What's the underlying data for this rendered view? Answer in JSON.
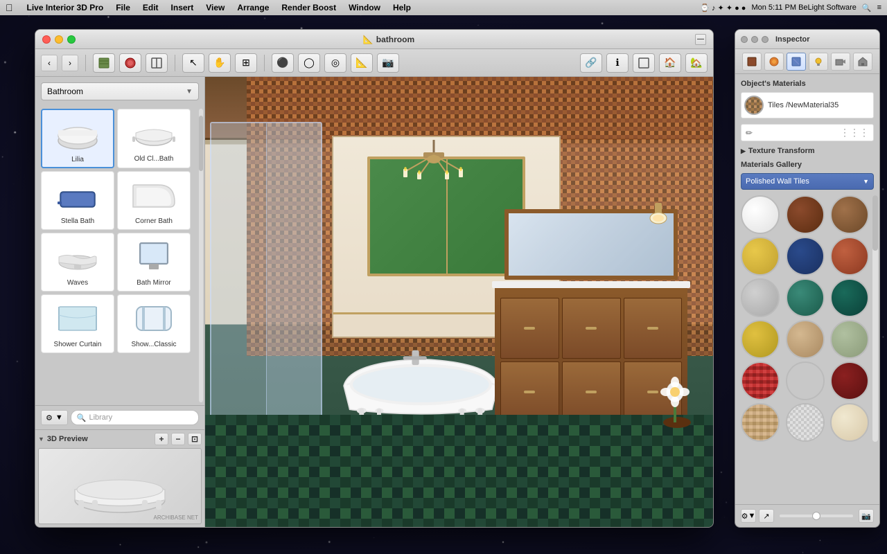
{
  "app": {
    "title": "Live Interior 3D Pro",
    "menu_items": [
      "File",
      "Edit",
      "Insert",
      "View",
      "Arrange",
      "Render Boost",
      "Window",
      "Help"
    ],
    "right_info": "Mon 5:11 PM",
    "company": "BeLight Software",
    "time_display": "Mon 5:11 PM   BeLight Software"
  },
  "main_window": {
    "title": "bathroom",
    "title_icon": "🏠"
  },
  "left_sidebar": {
    "category": "Bathroom",
    "items": [
      {
        "id": "lilia",
        "label": "Lilia",
        "selected": true
      },
      {
        "id": "old-bath",
        "label": "Old Cl...Bath"
      },
      {
        "id": "stella-bath",
        "label": "Stella Bath"
      },
      {
        "id": "corner-bath",
        "label": "Corner Bath"
      },
      {
        "id": "waves",
        "label": "Waves"
      },
      {
        "id": "bath-mirror",
        "label": "Bath Mirror"
      },
      {
        "id": "shower-curtain",
        "label": "Shower Curtain"
      },
      {
        "id": "show-classic",
        "label": "Show...Classic"
      }
    ],
    "search_placeholder": "Library",
    "preview_label": "3D Preview"
  },
  "inspector": {
    "title": "Inspector",
    "tabs": [
      "objects",
      "materials",
      "paint",
      "lights",
      "camera",
      "home"
    ],
    "objects_materials_label": "Object's Materials",
    "material_name": "Tiles /NewMaterial35",
    "texture_transform_label": "Texture Transform",
    "materials_gallery_label": "Materials Gallery",
    "gallery_selected": "Polished Wall Tiles",
    "materials": [
      {
        "id": "white",
        "class": "mat-white"
      },
      {
        "id": "dark-brown",
        "class": "mat-dark-brown"
      },
      {
        "id": "medium-brown",
        "class": "mat-medium-brown"
      },
      {
        "id": "yellow",
        "class": "mat-yellow"
      },
      {
        "id": "dark-blue",
        "class": "mat-dark-blue"
      },
      {
        "id": "terracotta",
        "class": "mat-terracotta"
      },
      {
        "id": "light-gray",
        "class": "mat-light-gray"
      },
      {
        "id": "teal",
        "class": "mat-teal"
      },
      {
        "id": "dark-teal",
        "class": "mat-dark-teal"
      },
      {
        "id": "gold-yellow",
        "class": "mat-gold-yellow"
      },
      {
        "id": "tan",
        "class": "mat-tan"
      },
      {
        "id": "sage",
        "class": "mat-sage"
      },
      {
        "id": "red-tile",
        "class": "mat-red-tile"
      },
      {
        "id": "blue-tile",
        "class": "mat-blue-tile"
      },
      {
        "id": "dark-red",
        "class": "mat-dark-red"
      },
      {
        "id": "tan-tile",
        "class": "mat-tan-tile"
      },
      {
        "id": "grid-tile",
        "class": "mat-grid-tile"
      },
      {
        "id": "cream",
        "class": "mat-cream"
      }
    ]
  },
  "toolbar": {
    "nav_back": "‹",
    "nav_forward": "›",
    "tools": [
      "cursor",
      "hand",
      "split",
      "record",
      "camera",
      "camera2",
      "measure",
      "photo"
    ],
    "right_tools": [
      "share",
      "info",
      "2d-view",
      "3d-house",
      "home-btn"
    ]
  }
}
